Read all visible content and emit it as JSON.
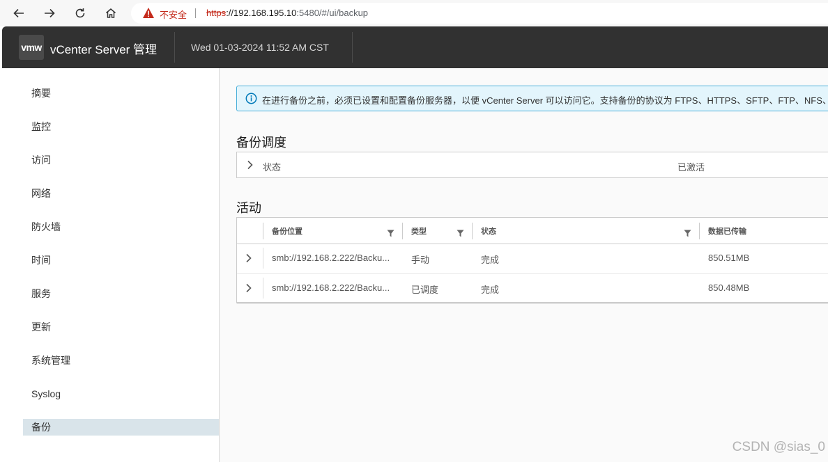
{
  "browser": {
    "security_label": "不安全",
    "url_scheme": "https",
    "url_host": "://192.168.195.10",
    "url_rest": ":5480/#/ui/backup"
  },
  "header": {
    "logo": "vmw",
    "title": "vCenter Server 管理",
    "datetime": "Wed 01-03-2024 11:52 AM CST"
  },
  "sidebar": {
    "items": [
      {
        "label": "摘要"
      },
      {
        "label": "监控"
      },
      {
        "label": "访问"
      },
      {
        "label": "网络"
      },
      {
        "label": "防火墙"
      },
      {
        "label": "时间"
      },
      {
        "label": "服务"
      },
      {
        "label": "更新"
      },
      {
        "label": "系统管理"
      },
      {
        "label": "Syslog"
      },
      {
        "label": "备份",
        "active": true
      }
    ]
  },
  "alert": {
    "message": "在进行备份之前，必须已设置和配置备份服务器，以便 vCenter Server 可以访问它。支持备份的协议为 FTPS、HTTPS、SFTP、FTP、NFS、"
  },
  "schedule": {
    "title": "备份调度",
    "status_label": "状态",
    "status_value": "已激活"
  },
  "activity": {
    "title": "活动",
    "columns": [
      "备份位置",
      "类型",
      "状态",
      "数据已传输"
    ],
    "rows": [
      {
        "location": "smb://192.168.2.222/Backu...",
        "type": "手动",
        "status": "完成",
        "data": "850.51MB"
      },
      {
        "location": "smb://192.168.2.222/Backu...",
        "type": "已调度",
        "status": "完成",
        "data": "850.48MB"
      }
    ]
  },
  "watermark": "CSDN @sias_0",
  "colors": {
    "header_bg": "#313131",
    "active_nav_bg": "#d9e4ea",
    "alert_border": "#49afd9",
    "alert_bg": "#e3f5fc",
    "warning_red": "#c42b1c"
  },
  "icons": [
    "back-icon",
    "forward-icon",
    "reload-icon",
    "home-icon",
    "warning-icon",
    "info-icon",
    "chevron-right-icon",
    "filter-icon"
  ]
}
